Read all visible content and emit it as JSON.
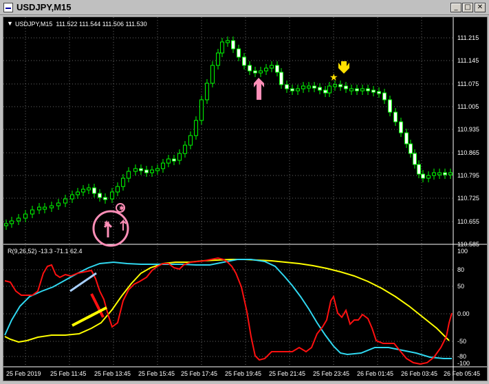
{
  "window": {
    "title": "USDJPY,M15",
    "minimize_glyph": "_",
    "maximize_glyph": "□",
    "close_glyph": "✕"
  },
  "colors": {
    "background": "#000000",
    "grid": "#6a6a6a",
    "candle": "#00ff00",
    "text": "#ffffff",
    "indicator_red": "#ff1010",
    "indicator_cyan": "#30d8f0",
    "indicator_yellow": "#ffff00",
    "arrow_pink": "#ff8fb8",
    "arrow_yellow": "#ffe000"
  },
  "main_chart": {
    "header": "USDJPY,M15  111.522 111.544 111.506 111.530",
    "price_labels": [
      "111.215",
      "111.145",
      "111.075",
      "111.005",
      "110.935",
      "110.865",
      "110.795",
      "110.725",
      "110.655",
      "110.585"
    ],
    "signals": [
      {
        "name": "buy-arrow-1",
        "type": "up",
        "color": "pink"
      },
      {
        "name": "buy-arrow-2",
        "type": "up",
        "color": "pink"
      },
      {
        "name": "sell-arrow",
        "type": "down",
        "color": "yellow"
      }
    ]
  },
  "indicator": {
    "header": "R(9,26,52) -13.3 -71.1 62.4",
    "level_labels": [
      "100",
      "80",
      "50",
      "0.00",
      "-50",
      "-80",
      "-100"
    ]
  },
  "time_axis": {
    "labels": [
      "25 Feb 2019",
      "25 Feb 11:45",
      "25 Feb 13:45",
      "25 Feb 15:45",
      "25 Feb 17:45",
      "25 Feb 19:45",
      "25 Feb 21:45",
      "25 Feb 23:45",
      "26 Feb 01:45",
      "26 Feb 03:45",
      "26 Feb 05:45"
    ]
  }
}
